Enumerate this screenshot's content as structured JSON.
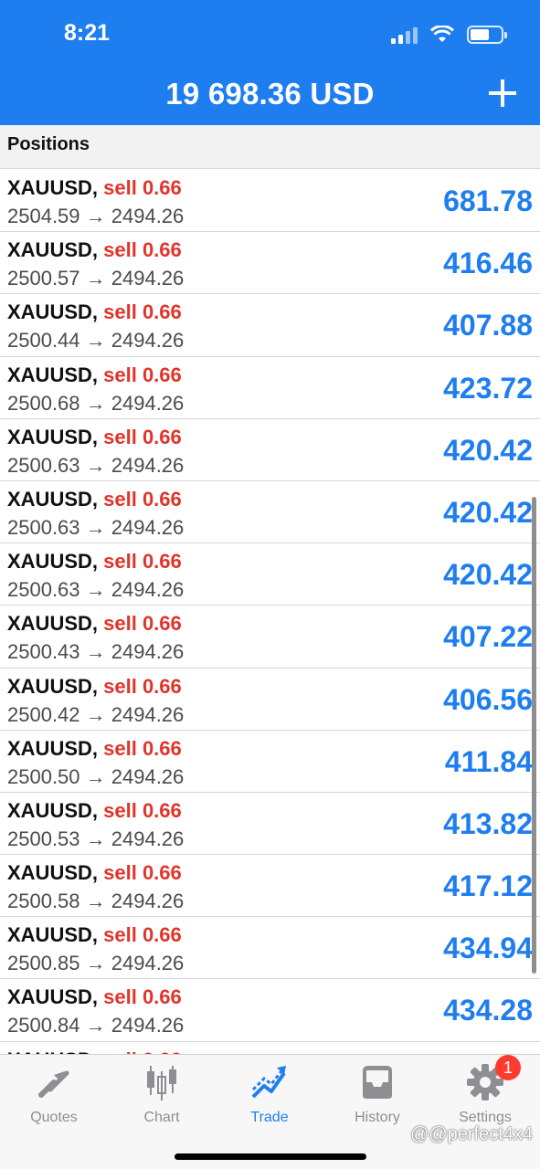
{
  "status_bar": {
    "time": "8:21"
  },
  "header": {
    "balance": "19 698.36 USD"
  },
  "section": {
    "title": "Positions"
  },
  "positions": [
    {
      "symbol": "XAUUSD,",
      "side": "sell 0.66",
      "prices": "2504.59 → 2494.26",
      "profit": "681.78"
    },
    {
      "symbol": "XAUUSD,",
      "side": "sell 0.66",
      "prices": "2500.57 → 2494.26",
      "profit": "416.46"
    },
    {
      "symbol": "XAUUSD,",
      "side": "sell 0.66",
      "prices": "2500.44 → 2494.26",
      "profit": "407.88"
    },
    {
      "symbol": "XAUUSD,",
      "side": "sell 0.66",
      "prices": "2500.68 → 2494.26",
      "profit": "423.72"
    },
    {
      "symbol": "XAUUSD,",
      "side": "sell 0.66",
      "prices": "2500.63 → 2494.26",
      "profit": "420.42"
    },
    {
      "symbol": "XAUUSD,",
      "side": "sell 0.66",
      "prices": "2500.63 → 2494.26",
      "profit": "420.42"
    },
    {
      "symbol": "XAUUSD,",
      "side": "sell 0.66",
      "prices": "2500.63 → 2494.26",
      "profit": "420.42"
    },
    {
      "symbol": "XAUUSD,",
      "side": "sell 0.66",
      "prices": "2500.43 → 2494.26",
      "profit": "407.22"
    },
    {
      "symbol": "XAUUSD,",
      "side": "sell 0.66",
      "prices": "2500.42 → 2494.26",
      "profit": "406.56"
    },
    {
      "symbol": "XAUUSD,",
      "side": "sell 0.66",
      "prices": "2500.50 → 2494.26",
      "profit": "411.84"
    },
    {
      "symbol": "XAUUSD,",
      "side": "sell 0.66",
      "prices": "2500.53 → 2494.26",
      "profit": "413.82"
    },
    {
      "symbol": "XAUUSD,",
      "side": "sell 0.66",
      "prices": "2500.58 → 2494.26",
      "profit": "417.12"
    },
    {
      "symbol": "XAUUSD,",
      "side": "sell 0.66",
      "prices": "2500.85 → 2494.26",
      "profit": "434.94"
    },
    {
      "symbol": "XAUUSD,",
      "side": "sell 0.66",
      "prices": "2500.84 → 2494.26",
      "profit": "434.28"
    }
  ],
  "tabs": [
    {
      "label": "Quotes",
      "icon": "quotes-arrows-icon"
    },
    {
      "label": "Chart",
      "icon": "candlestick-icon"
    },
    {
      "label": "Trade",
      "icon": "trend-line-icon",
      "active": true
    },
    {
      "label": "History",
      "icon": "inbox-tray-icon"
    },
    {
      "label": "Settings",
      "icon": "gear-icon",
      "badge": "1"
    }
  ],
  "watermark": "@@perfect4x4",
  "colors": {
    "accent": "#1e7ef0",
    "sell": "#e0342a",
    "badge": "#ff3b30"
  }
}
